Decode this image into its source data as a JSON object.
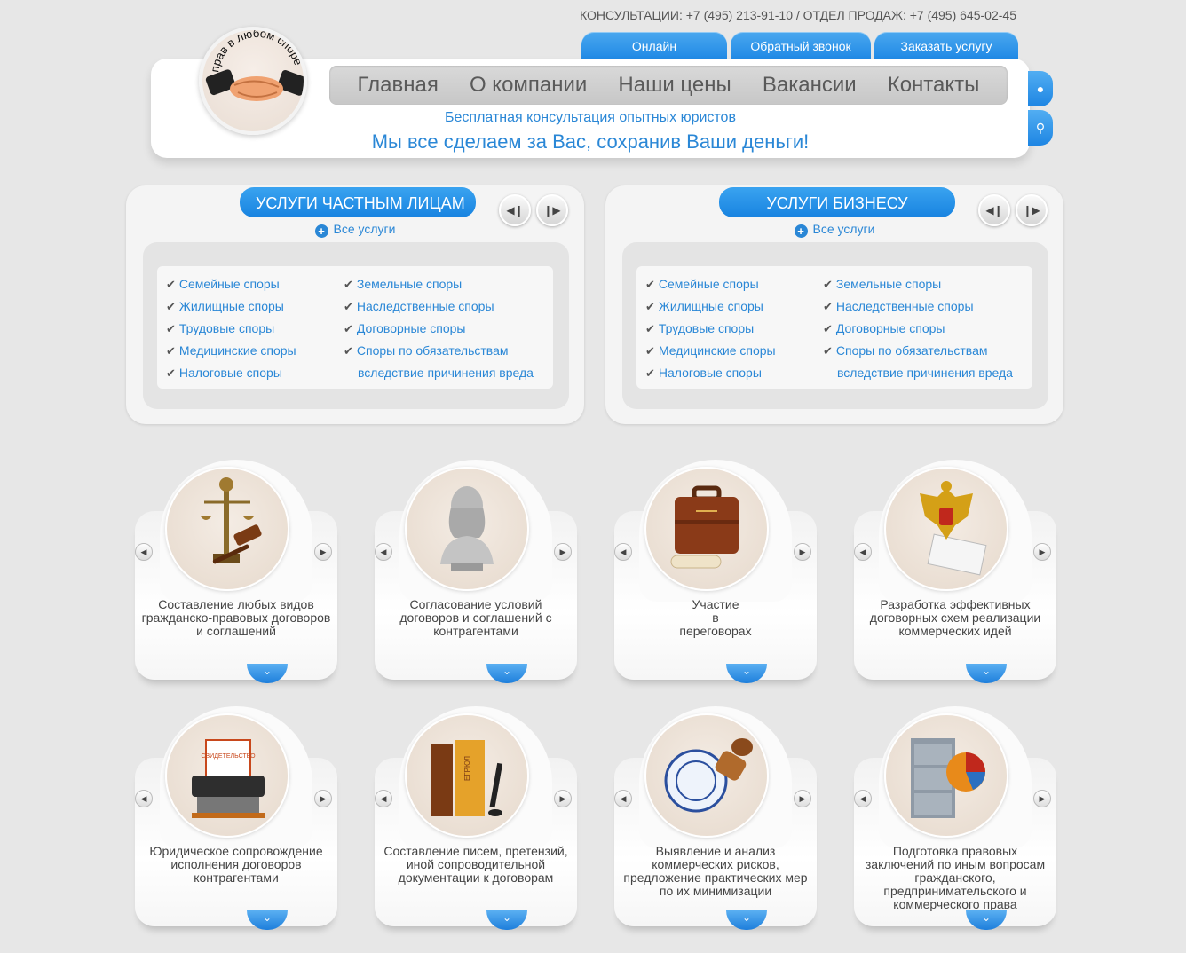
{
  "header": {
    "contacts": "КОНСУЛЬТАЦИИ: +7 (495) 213-91-10 / ОТДЕЛ ПРОДАЖ: +7 (495) 645-02-45",
    "tabs": [
      "Онлайн консультация",
      "Обратный звонок",
      "Заказать услугу"
    ],
    "logo_text": "прав в любом споре",
    "nav": [
      "Главная",
      "О компании",
      "Наши цены",
      "Вакансии",
      "Контакты"
    ],
    "tagline_small": "Бесплатная консультация опытных юристов",
    "tagline_big": "Мы все сделаем за Вас, сохранив Ваши деньги!"
  },
  "private": {
    "title": "УСЛУГИ ЧАСТНЫМ ЛИЦАМ",
    "all_link": "Все услуги",
    "col1": [
      "Семейные споры",
      "Жилищные споры",
      "Трудовые споры",
      "Медицинские споры",
      "Налоговые споры"
    ],
    "col2": [
      "Земельные споры",
      "Наследственные споры",
      "Договорные споры",
      "Споры по обязательствам"
    ],
    "col2_cont": "вследствие причинения вреда"
  },
  "business": {
    "title": "УСЛУГИ БИЗНЕСУ",
    "all_link": "Все услуги",
    "col1": [
      "Семейные споры",
      "Жилищные споры",
      "Трудовые споры",
      "Медицинские споры",
      "Налоговые споры"
    ],
    "col2": [
      "Земельные споры",
      "Наследственные споры",
      "Договорные споры",
      "Споры по обязательствам"
    ],
    "col2_cont": "вследствие причинения вреда"
  },
  "cards": [
    {
      "text": "Составление любых видов гражданско-правовых договоров и соглашений",
      "icon": "themis-gavel-icon"
    },
    {
      "text": "Согласование условий договоров и соглашений с контрагентами",
      "icon": "bust-icon"
    },
    {
      "text": "Участие\nв\nпереговорах",
      "icon": "briefcase-icon"
    },
    {
      "text": "Разработка эффективных договорных схем реализации коммерческих идей",
      "icon": "coat-of-arms-icon"
    },
    {
      "text": "Юридическое сопровождение исполнения договоров контрагентами",
      "icon": "shredder-certificate-icon",
      "stamp": "СВИДЕТЕЛЬСТВО"
    },
    {
      "text": "Составление писем, претензий, иной сопроводительной документации к договорам",
      "icon": "folders-icon",
      "stamp": "ЕГРЮЛ"
    },
    {
      "text": "Выявление и анализ коммерческих рисков, предложение практических мер по их минимизации",
      "icon": "seal-stamp-icon"
    },
    {
      "text": "Подготовка правовых заключений по иным вопросам гражданского, предпринимательского и коммерческого права",
      "icon": "cabinet-chart-icon"
    }
  ],
  "colors": {
    "accent": "#2a87d6",
    "tab": "#1e88e5",
    "bg": "#e7e7e7"
  }
}
